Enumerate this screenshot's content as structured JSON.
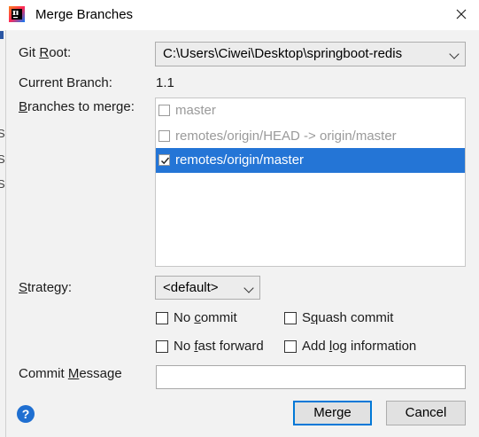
{
  "window": {
    "title": "Merge Branches",
    "close_glyph": "✕",
    "app_icon": "intellij-icon"
  },
  "background_window": {
    "letters": [
      "S",
      "S",
      "S"
    ]
  },
  "git_root": {
    "label_prefix": "Git ",
    "label_mnemonic": "R",
    "label_suffix": "oot:",
    "value": "C:\\Users\\Ciwei\\Desktop\\springboot-redis"
  },
  "current_branch": {
    "label": "Current Branch:",
    "value": "1.1"
  },
  "branches": {
    "label_mnemonic": "B",
    "label_suffix": "ranches to merge:",
    "items": [
      {
        "label": "master",
        "checked": false,
        "selected": false
      },
      {
        "label": "remotes/origin/HEAD -> origin/master",
        "checked": false,
        "selected": false
      },
      {
        "label": "remotes/origin/master",
        "checked": true,
        "selected": true
      }
    ]
  },
  "strategy": {
    "label_mnemonic": "S",
    "label_suffix": "trategy:",
    "value": "<default>"
  },
  "options": {
    "no_commit": {
      "prefix": "No ",
      "mnemonic": "c",
      "suffix": "ommit",
      "checked": false
    },
    "squash_commit": {
      "prefix": "S",
      "mnemonic": "q",
      "suffix": "uash commit",
      "checked": false
    },
    "no_fast_forward": {
      "prefix": "No ",
      "mnemonic": "f",
      "suffix": "ast forward",
      "checked": false
    },
    "add_log_information": {
      "prefix": "Add ",
      "mnemonic": "l",
      "suffix": "og information",
      "checked": false
    }
  },
  "commit_message": {
    "label_prefix": "Commit ",
    "label_mnemonic": "M",
    "label_suffix": "essage",
    "value": ""
  },
  "buttons": {
    "merge": "Merge",
    "cancel": "Cancel",
    "help": "?"
  },
  "colors": {
    "selection": "#2475d6",
    "primary_border": "#0078d7",
    "help_blue": "#1f6fd1"
  }
}
